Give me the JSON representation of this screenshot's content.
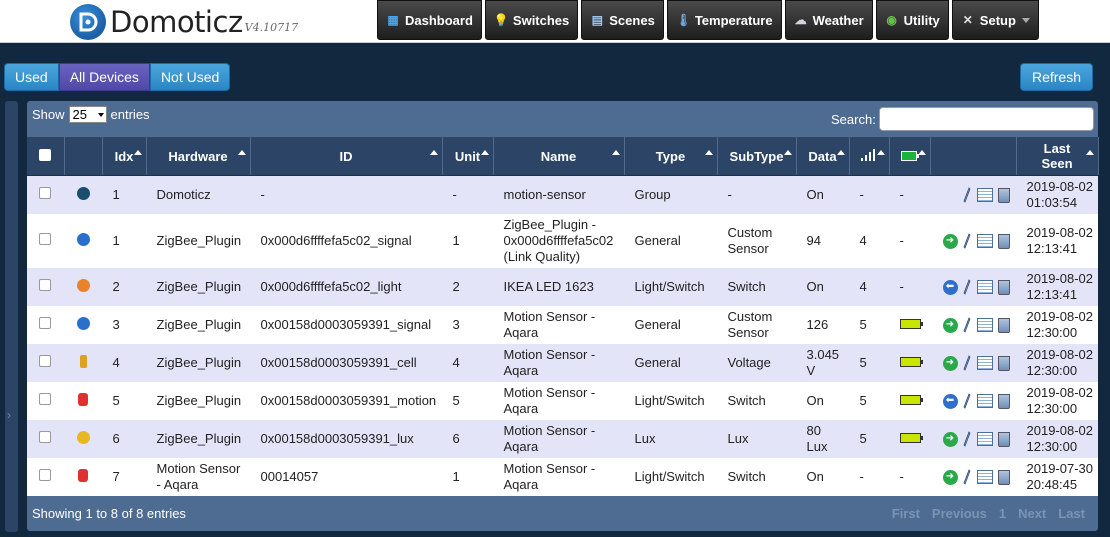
{
  "app": {
    "name": "Domoticz",
    "version": "V4.10717"
  },
  "nav": [
    {
      "label": "Dashboard",
      "icon": "dashboard-icon"
    },
    {
      "label": "Switches",
      "icon": "lightbulb-icon"
    },
    {
      "label": "Scenes",
      "icon": "scenes-icon"
    },
    {
      "label": "Temperature",
      "icon": "thermometer-icon"
    },
    {
      "label": "Weather",
      "icon": "weather-icon"
    },
    {
      "label": "Utility",
      "icon": "utility-icon"
    },
    {
      "label": "Setup",
      "icon": "tools-icon"
    }
  ],
  "filters": {
    "used": "Used",
    "all": "All Devices",
    "not_used": "Not Used",
    "active": "All Devices"
  },
  "refresh": "Refresh",
  "table": {
    "show_prefix": "Show",
    "show_value": "25",
    "show_suffix": "entries",
    "search_label": "Search:",
    "search_value": "",
    "headers": [
      "Idx",
      "Hardware",
      "ID",
      "Unit",
      "Name",
      "Type",
      "SubType",
      "Data",
      "Last\nSeen"
    ],
    "rows": [
      {
        "idx": "1",
        "hardware": "Domoticz",
        "id": "-",
        "unit": "-",
        "name": "motion-sensor",
        "type": "Group",
        "subtype": "-",
        "data": "On",
        "signal": "-",
        "battery": "-",
        "last_seen": "2019-08-02\n01:03:54",
        "icon": "group-icon",
        "icon_color": "#1a4d6e",
        "action": "none"
      },
      {
        "idx": "1",
        "hardware": "ZigBee_Plugin",
        "id": "0x000d6ffffefa5c02_signal",
        "unit": "1",
        "name": "ZigBee_Plugin -\n0x000d6ffffefa5c02\n(Link Quality)",
        "type": "General",
        "subtype": "Custom\nSensor",
        "data": "94",
        "signal": "4",
        "battery": "-",
        "last_seen": "2019-08-02\n12:13:41",
        "icon": "globe-icon",
        "icon_color": "#2a6fc9",
        "action": "green"
      },
      {
        "idx": "2",
        "hardware": "ZigBee_Plugin",
        "id": "0x000d6ffffefa5c02_light",
        "unit": "2",
        "name": "IKEA LED 1623",
        "type": "Light/Switch",
        "subtype": "Switch",
        "data": "On",
        "signal": "4",
        "battery": "-",
        "last_seen": "2019-08-02\n12:13:41",
        "icon": "bulb-on-icon",
        "icon_color": "#e8832a",
        "action": "blue"
      },
      {
        "idx": "3",
        "hardware": "ZigBee_Plugin",
        "id": "0x00158d0003059391_signal",
        "unit": "3",
        "name": "Motion Sensor -\nAqara",
        "type": "General",
        "subtype": "Custom\nSensor",
        "data": "126",
        "signal": "5",
        "battery": "bat",
        "last_seen": "2019-08-02\n12:30:00",
        "icon": "globe-icon",
        "icon_color": "#2a6fc9",
        "action": "green"
      },
      {
        "idx": "4",
        "hardware": "ZigBee_Plugin",
        "id": "0x00158d0003059391_cell",
        "unit": "4",
        "name": "Motion Sensor -\nAqara",
        "type": "General",
        "subtype": "Voltage",
        "data": "3.045\nV",
        "signal": "5",
        "battery": "bat",
        "last_seen": "2019-08-02\n12:30:00",
        "icon": "voltage-icon",
        "icon_color": "#e0a020",
        "action": "green"
      },
      {
        "idx": "5",
        "hardware": "ZigBee_Plugin",
        "id": "0x00158d0003059391_motion",
        "unit": "5",
        "name": "Motion Sensor -\nAqara",
        "type": "Light/Switch",
        "subtype": "Switch",
        "data": "On",
        "signal": "5",
        "battery": "bat",
        "last_seen": "2019-08-02\n12:30:00",
        "icon": "motion-icon",
        "icon_color": "#e03030",
        "action": "blue"
      },
      {
        "idx": "6",
        "hardware": "ZigBee_Plugin",
        "id": "0x00158d0003059391_lux",
        "unit": "6",
        "name": "Motion Sensor -\nAqara",
        "type": "Lux",
        "subtype": "Lux",
        "data": "80\nLux",
        "signal": "5",
        "battery": "bat",
        "last_seen": "2019-08-02\n12:30:00",
        "icon": "lux-icon",
        "icon_color": "#e8b820",
        "action": "green"
      },
      {
        "idx": "7",
        "hardware": "Motion Sensor\n- Aqara",
        "id": "00014057",
        "unit": "1",
        "name": "Motion Sensor -\nAqara",
        "type": "Light/Switch",
        "subtype": "Switch",
        "data": "On",
        "signal": "-",
        "battery": "-",
        "last_seen": "2019-07-30\n20:48:45",
        "icon": "motion-icon",
        "icon_color": "#e03030",
        "action": "green"
      }
    ],
    "info": "Showing 1 to 8 of 8 entries",
    "pager": [
      "First",
      "Previous",
      "1",
      "Next",
      "Last"
    ]
  },
  "colors": {
    "battery": "#c8e600",
    "action_green": "#2aa84a",
    "action_blue": "#2f6fcc"
  }
}
